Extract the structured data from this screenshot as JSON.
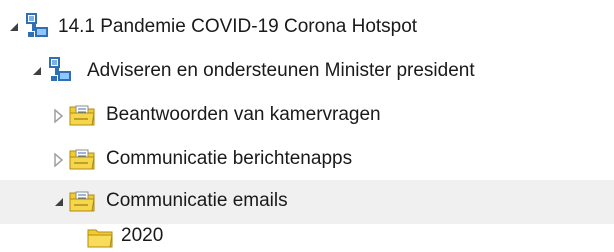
{
  "tree": {
    "nodes": [
      {
        "label": "14.1 Pandemie COVID-19 Corona Hotspot",
        "state": "expanded",
        "icon": "network-folder-icon",
        "selected": false
      },
      {
        "label": "Adviseren en ondersteunen Minister president",
        "state": "expanded",
        "icon": "network-folder-icon",
        "selected": false
      },
      {
        "label": "Beantwoorden van kamervragen",
        "state": "collapsed",
        "icon": "document-folder-icon",
        "selected": false
      },
      {
        "label": "Communicatie berichtenapps",
        "state": "collapsed",
        "icon": "document-folder-icon",
        "selected": false
      },
      {
        "label": "Communicatie emails",
        "state": "expanded",
        "icon": "document-folder-icon",
        "selected": true
      },
      {
        "label": "2020",
        "state": "leaf",
        "icon": "folder-icon",
        "selected": false
      }
    ]
  },
  "colors": {
    "selected_row": "#f0f0f0",
    "expanded_arrow": "#404040",
    "collapsed_arrow": "#a0a0a0",
    "folder_yellow": "#f2cc2d",
    "network_blue": "#2f6fb3"
  }
}
